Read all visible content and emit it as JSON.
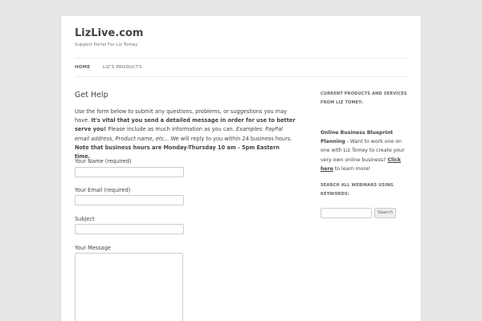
{
  "site": {
    "title": "LizLive.com",
    "description": "Support Portal For Liz Tomey"
  },
  "nav": {
    "items": [
      {
        "label": "HOME"
      },
      {
        "label": "LIZ'S PRODUCTS"
      }
    ]
  },
  "main": {
    "heading": "Get Help",
    "intro": {
      "p1": "Use the form below to submit any questions, problems, or suggestions you may have. ",
      "p1_bold": "It's vital that you send a detailed message in order for use to better serve you!",
      "p2": " Please include as much information as you can. ",
      "p2_italic": "Examples: PayPal email address, Product name, etc...",
      "p3": " We will reply to you within 24 business hours. ",
      "p3_bold": "Note that business hours are Monday-Thursday 10 am - 5pm Eastern time."
    },
    "form": {
      "name_label": "Your Name (required)",
      "email_label": "Your Email (required)",
      "subject_label": "Subject",
      "message_label": "Your Message"
    }
  },
  "sidebar": {
    "products_title": "CURRENT PRODUCTS AND SERVICES FROM LIZ TOMEY:",
    "product_name": "Online Business Blueprint Planning",
    "product_text": " - Want to work one on one with Liz Tomey to create your very own online business? ",
    "product_link": "Click here",
    "product_tail": " to learn more!",
    "search_title": "SEARCH ALL WEBINARS USING KEYWORDS:",
    "search_button": "Search"
  }
}
